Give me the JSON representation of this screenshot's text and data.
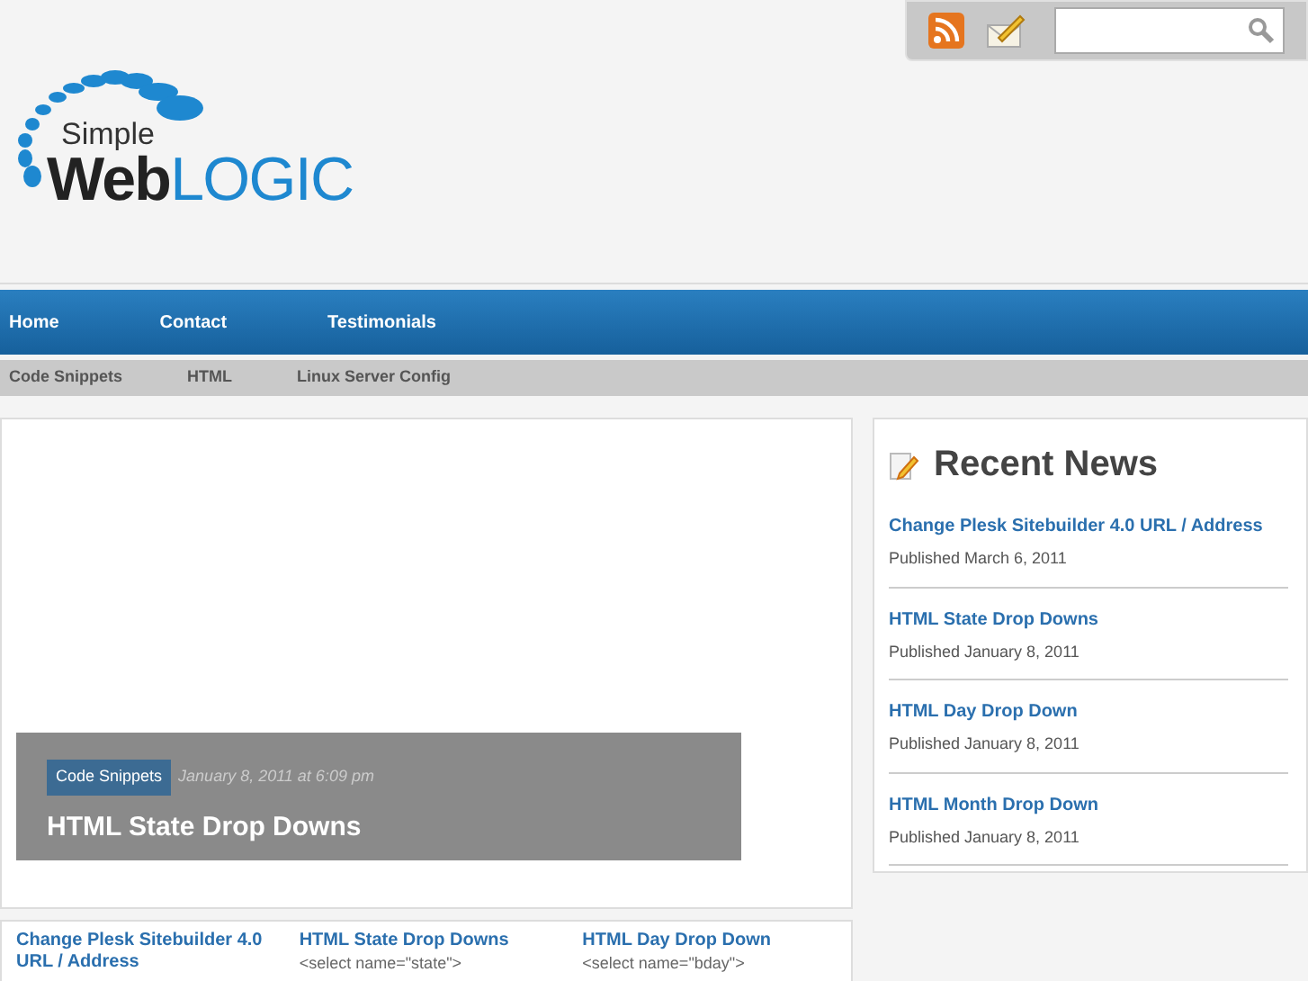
{
  "logo": {
    "small": "Simple",
    "bold": "Web",
    "accent": "LOGIC"
  },
  "nav": [
    {
      "label": "Home",
      "selected": false
    },
    {
      "label": "Contact",
      "selected": false
    },
    {
      "label": "Testimonials",
      "selected": false
    }
  ],
  "subnav": [
    {
      "label": "Code Snippets"
    },
    {
      "label": "HTML"
    },
    {
      "label": "Linux Server Config"
    }
  ],
  "slide": {
    "category": "Code Snippets",
    "date": "January 8, 2011 at 6:09 pm",
    "title": "HTML State Drop Downs"
  },
  "recent_news": {
    "title": "Recent News",
    "items": [
      {
        "title": "Change Plesk Sitebuilder 4.0 URL / Address",
        "meta": "Published March 6, 2011"
      },
      {
        "title": "HTML State Drop Downs",
        "meta": "Published January 8, 2011"
      },
      {
        "title": "HTML Day Drop Down",
        "meta": "Published January 8, 2011"
      },
      {
        "title": "HTML Month Drop Down",
        "meta": "Published January 8, 2011"
      }
    ]
  },
  "posts": [
    {
      "title": "Change Plesk Sitebuilder 4.0 URL / Address"
    },
    {
      "title": "HTML State Drop Downs",
      "excerpt": "<select name=\"state\">"
    },
    {
      "title": "HTML Day Drop Down",
      "excerpt": "<select name=\"bday\">"
    }
  ]
}
